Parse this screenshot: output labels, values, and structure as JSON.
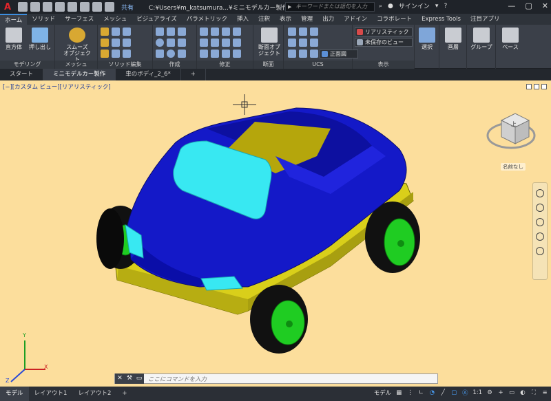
{
  "titlebar": {
    "app_letter": "A",
    "share_label": "共有",
    "file_title": "C:¥Users¥m_katsumura...¥ミニモデルカー製作.dwg",
    "search_placeholder": "キーワードまたは語句を入力",
    "signin": "サインイン",
    "help": "?"
  },
  "ribbon_tabs": [
    "ホーム",
    "ソリッド",
    "サーフェス",
    "メッシュ",
    "ビジュアライズ",
    "パラメトリック",
    "挿入",
    "注釈",
    "表示",
    "管理",
    "出力",
    "アドイン",
    "コラボレート",
    "Express Tools",
    "注目アプリ"
  ],
  "ribbon_active_tab": "ホーム",
  "panels": {
    "modeling": "モデリング",
    "mesh": "メッシュ",
    "solid_edit": "ソリッド編集",
    "draw": "作成",
    "modify": "修正",
    "section": "断面",
    "ucs": "UCS",
    "view": "表示"
  },
  "buttons": {
    "box": "直方体",
    "extrude": "押し出し",
    "smooth": "スムーズ オブジェクト",
    "section_plane": "断面オブ ジェクト",
    "select": "選択",
    "layers": "画層",
    "groups": "グループ",
    "base": "ベース"
  },
  "combos": {
    "visual_style": "リアリスティック",
    "named_view": "未保存のビュー",
    "ucs_view": "正面図"
  },
  "doc_tabs": [
    "スタート",
    "ミニモデルカー製作",
    "車のボディ_2_6*"
  ],
  "doc_tab_active": "ミニモデルカー製作",
  "viewport": {
    "label": "[−][カスタム ビュー][リアリスティック]",
    "viewcube_top": "上",
    "named": "名前なし",
    "axis_x": "X",
    "axis_y": "Y",
    "axis_z": "Z"
  },
  "command": {
    "placeholder": "ここにコマンドを入力"
  },
  "status": {
    "tabs": [
      "モデル",
      "レイアウト1",
      "レイアウト2"
    ],
    "model": "モデル",
    "scale": "1:1",
    "add": "+"
  },
  "colors": {
    "viewport_bg": "#fcde9c",
    "body": "#1419c8",
    "glass": "#38e8f2",
    "base": "#d9cf1a",
    "tire": "#101010",
    "hub": "#1fcc22"
  }
}
